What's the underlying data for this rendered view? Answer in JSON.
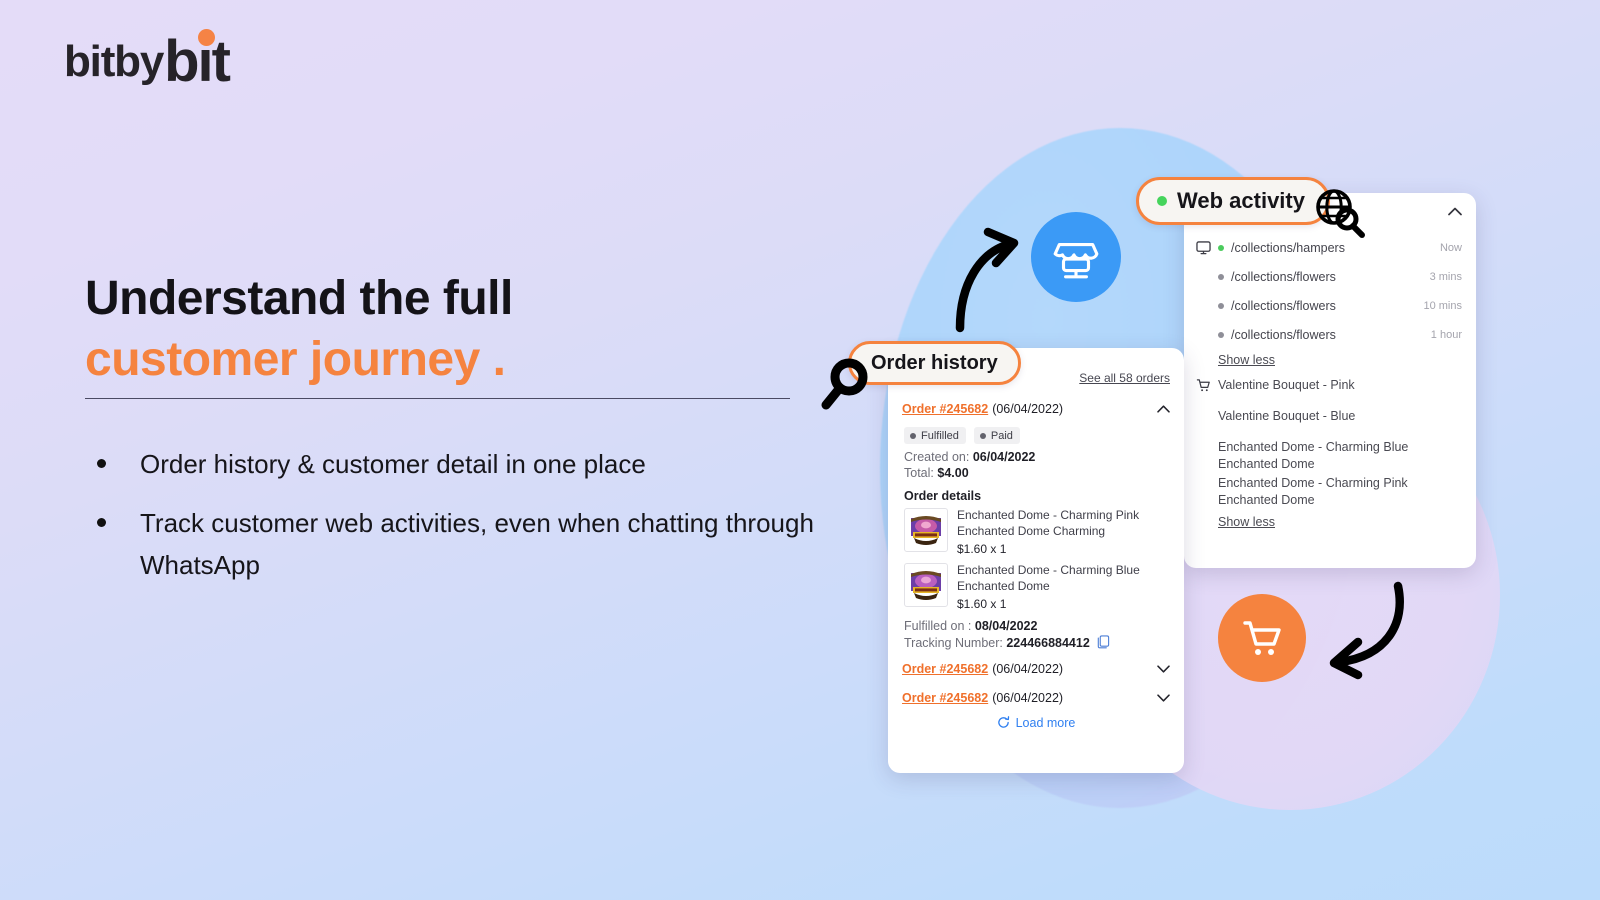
{
  "brand": {
    "logo_part1": "bit",
    "logo_part2": "by",
    "logo_part3": "bit",
    "accent_color": "#f5833f",
    "dark_color": "#262329"
  },
  "hero": {
    "headline_line1": "Understand the full",
    "headline_line2": "customer journey .",
    "bullets": [
      "Order history & customer detail in one place",
      "Track customer web activities, even when chatting through WhatsApp"
    ]
  },
  "web_activity": {
    "pill_label": "Web activity",
    "status_dot_color": "#45d45c",
    "collapse_icon": "chevron-up-icon",
    "pages": [
      {
        "path": "/collections/hampers",
        "time": "Now",
        "live": true
      },
      {
        "path": "/collections/flowers",
        "time": "3 mins",
        "live": false
      },
      {
        "path": "/collections/flowers",
        "time": "10 mins",
        "live": false
      },
      {
        "path": "/collections/flowers",
        "time": "1 hour",
        "live": false
      }
    ],
    "pages_show_less": "Show less",
    "cart_items": [
      "Valentine Bouquet - Pink",
      "Valentine Bouquet - Blue",
      "Enchanted Dome - Charming Blue Enchanted Dome",
      "Enchanted Dome - Charming Pink Enchanted Dome"
    ],
    "cart_show_less": "Show less"
  },
  "order_history": {
    "pill_label": "Order history",
    "see_all_label": "See all 58 orders",
    "expanded_order": {
      "number": "Order #245682",
      "date": "(06/04/2022)",
      "chevron": "chevron-up-icon",
      "tags": [
        "Fulfilled",
        "Paid"
      ],
      "created_label": "Created on:",
      "created_value": "06/04/2022",
      "total_label": "Total:",
      "total_value": "$4.00",
      "details_title": "Order details",
      "items": [
        {
          "name": "Enchanted Dome - Charming Pink Enchanted Dome Charming",
          "price": "$1.60 x 1"
        },
        {
          "name": "Enchanted Dome - Charming Blue Enchanted Dome",
          "price": "$1.60 x 1"
        }
      ],
      "fulfilled_label": "Fulfilled on :",
      "fulfilled_value": "08/04/2022",
      "tracking_label": "Tracking Number:",
      "tracking_value": "224466884412"
    },
    "collapsed_orders": [
      {
        "number": "Order #245682",
        "date": "(06/04/2022)",
        "chevron": "chevron-down-icon"
      },
      {
        "number": "Order #245682",
        "date": "(06/04/2022)",
        "chevron": "chevron-down-icon"
      }
    ],
    "load_more_label": "Load more"
  },
  "icons": {
    "store_badge": "storefront-icon",
    "cart_badge": "shopping-cart-icon",
    "order_magnifier": "magnifying-glass-icon",
    "web_magnifier": "globe-search-icon",
    "monitor": "monitor-icon",
    "cart_small": "cart-outline-icon",
    "copy": "copy-icon",
    "refresh": "refresh-icon",
    "arrow_top": "curved-arrow-right-icon",
    "arrow_bottom": "curved-arrow-left-icon"
  }
}
